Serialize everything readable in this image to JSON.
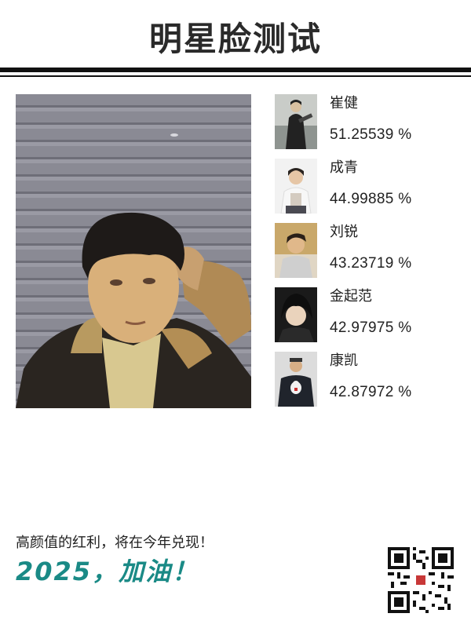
{
  "header": {
    "title": "明星脸测试"
  },
  "main_photo": {
    "icon": "user-selfie-photo"
  },
  "results": [
    {
      "name": "崔健",
      "score": "51.25539 %",
      "icon": "celebrity-thumbnail"
    },
    {
      "name": "成青",
      "score": "44.99885 %",
      "icon": "celebrity-thumbnail"
    },
    {
      "name": "刘锐",
      "score": "43.23719 %",
      "icon": "celebrity-thumbnail"
    },
    {
      "name": "金起范",
      "score": "42.97975 %",
      "icon": "celebrity-thumbnail"
    },
    {
      "name": "康凯",
      "score": "42.87972 %",
      "icon": "celebrity-thumbnail"
    }
  ],
  "footer": {
    "slogan": "高颜值的红利，将在今年兑现！",
    "cheer": "2025，加油！",
    "qr_icon": "qr-code-icon"
  },
  "colors": {
    "title": "#2a2a2a",
    "rule": "#111111",
    "cheer": "#1a8a86"
  }
}
